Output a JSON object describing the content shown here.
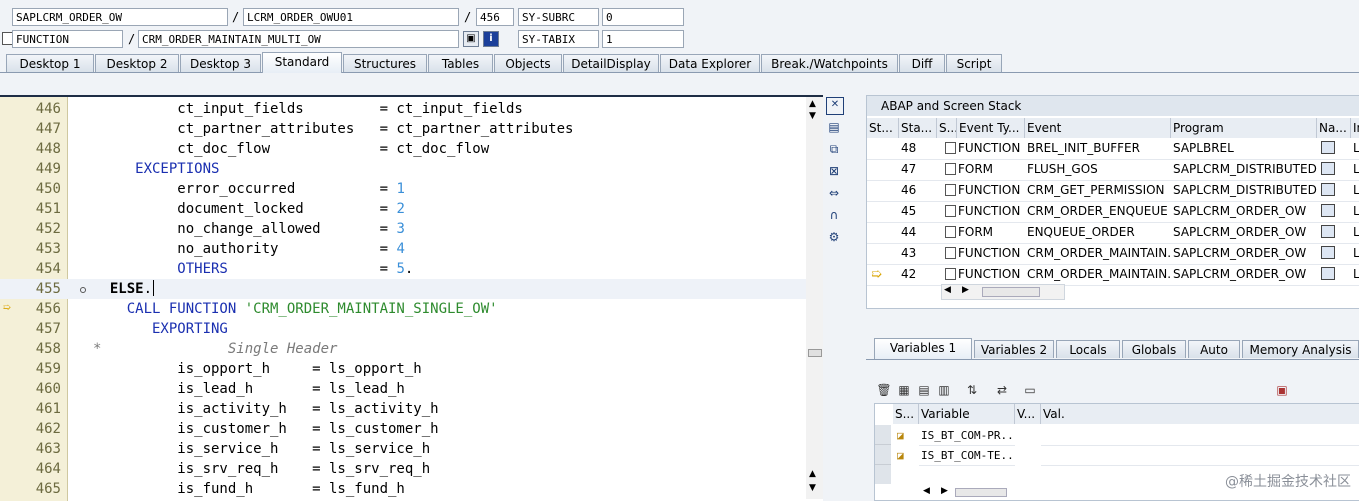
{
  "header": {
    "program": "SAPLCRM_ORDER_OW",
    "include": "LCRM_ORDER_OWU01",
    "line": "456",
    "sy_subrc_label": "SY-SUBRC",
    "sy_subrc_value": "0",
    "block_type": "FUNCTION",
    "block_name": "CRM_ORDER_MAINTAIN_MULTI_OW",
    "sy_tabix_label": "SY-TABIX",
    "sy_tabix_value": "1",
    "sep": "/"
  },
  "tabs": [
    "Desktop 1",
    "Desktop 2",
    "Desktop 3",
    "Standard",
    "Structures",
    "Tables",
    "Objects",
    "DetailDisplay",
    "Data Explorer",
    "Break./Watchpoints",
    "Diff",
    "Script"
  ],
  "active_tab": "Standard",
  "code": {
    "lines": [
      {
        "n": "446",
        "parts": [
          [
            "txt",
            "          ct_input_fields         = ct_input_fields"
          ]
        ]
      },
      {
        "n": "447",
        "parts": [
          [
            "txt",
            "          ct_partner_attributes   = ct_partner_attributes"
          ]
        ]
      },
      {
        "n": "448",
        "parts": [
          [
            "txt",
            "          ct_doc_flow             = ct_doc_flow"
          ]
        ]
      },
      {
        "n": "449",
        "parts": [
          [
            "kw",
            "     EXCEPTIONS"
          ]
        ]
      },
      {
        "n": "450",
        "parts": [
          [
            "txt",
            "          error_occurred          = "
          ],
          [
            "num",
            "1"
          ]
        ]
      },
      {
        "n": "451",
        "parts": [
          [
            "txt",
            "          document_locked         = "
          ],
          [
            "num",
            "2"
          ]
        ]
      },
      {
        "n": "452",
        "parts": [
          [
            "txt",
            "          no_change_allowed       = "
          ],
          [
            "num",
            "3"
          ]
        ]
      },
      {
        "n": "453",
        "parts": [
          [
            "txt",
            "          no_authority            = "
          ],
          [
            "num",
            "4"
          ]
        ]
      },
      {
        "n": "454",
        "parts": [
          [
            "kw",
            "          OTHERS"
          ],
          [
            "txt",
            "                  = "
          ],
          [
            "num",
            "5"
          ],
          [
            "txt",
            "."
          ]
        ]
      },
      {
        "n": "455",
        "parts": [
          [
            "bold",
            "  ELSE"
          ],
          [
            "txt",
            "."
          ]
        ]
      },
      {
        "n": "456",
        "parts": [
          [
            "kw",
            "    CALL FUNCTION "
          ],
          [
            "str",
            "'CRM_ORDER_MAINTAIN_SINGLE_OW'"
          ]
        ]
      },
      {
        "n": "457",
        "parts": [
          [
            "kw",
            "       EXPORTING"
          ]
        ]
      },
      {
        "n": "458",
        "parts": [
          [
            "cmt",
            "*               Single Header"
          ]
        ]
      },
      {
        "n": "459",
        "parts": [
          [
            "txt",
            "          is_opport_h     = ls_opport_h"
          ]
        ]
      },
      {
        "n": "460",
        "parts": [
          [
            "txt",
            "          is_lead_h       = ls_lead_h"
          ]
        ]
      },
      {
        "n": "461",
        "parts": [
          [
            "txt",
            "          is_activity_h   = ls_activity_h"
          ]
        ]
      },
      {
        "n": "462",
        "parts": [
          [
            "txt",
            "          is_customer_h   = ls_customer_h"
          ]
        ]
      },
      {
        "n": "463",
        "parts": [
          [
            "txt",
            "          is_service_h    = ls_service_h"
          ]
        ]
      },
      {
        "n": "464",
        "parts": [
          [
            "txt",
            "          is_srv_req_h    = ls_srv_req_h"
          ]
        ]
      },
      {
        "n": "465",
        "parts": [
          [
            "txt",
            "          is_fund_h       = ls_fund_h"
          ]
        ]
      }
    ],
    "current_line": "456",
    "cursor_line": "455"
  },
  "stack": {
    "title": "ABAP and Screen Stack",
    "columns": [
      "St...",
      "Sta...",
      "S...",
      "Event Ty...",
      "Event",
      "Program",
      "Na...",
      "In"
    ],
    "rows": [
      {
        "level": "48",
        "type": "FUNCTION",
        "event": "BREL_INIT_BUFFER",
        "program": "SAPLBREL",
        "inc": "LB"
      },
      {
        "level": "47",
        "type": "FORM",
        "event": "FLUSH_GOS",
        "program": "SAPLCRM_DISTRIBUTED...",
        "inc": "LC"
      },
      {
        "level": "46",
        "type": "FUNCTION",
        "event": "CRM_GET_PERMISSION",
        "program": "SAPLCRM_DISTRIBUTED...",
        "inc": "LC"
      },
      {
        "level": "45",
        "type": "FUNCTION",
        "event": "CRM_ORDER_ENQUEUE",
        "program": "SAPLCRM_ORDER_OW",
        "inc": "LC"
      },
      {
        "level": "44",
        "type": "FORM",
        "event": "ENQUEUE_ORDER",
        "program": "SAPLCRM_ORDER_OW",
        "inc": "LC"
      },
      {
        "level": "43",
        "type": "FUNCTION",
        "event": "CRM_ORDER_MAINTAIN...",
        "program": "SAPLCRM_ORDER_OW",
        "inc": "LC"
      },
      {
        "level": "42",
        "type": "FUNCTION",
        "event": "CRM_ORDER_MAINTAIN...",
        "program": "SAPLCRM_ORDER_OW",
        "inc": "LC",
        "current": true
      }
    ]
  },
  "var_tabs": [
    "Variables 1",
    "Variables 2",
    "Locals",
    "Globals",
    "Auto",
    "Memory Analysis"
  ],
  "var_active_tab": "Variables 1",
  "vars": {
    "columns": [
      "S...",
      "Variable",
      "V...",
      "Val."
    ],
    "rows": [
      {
        "name": "IS_BT_COM-PR...",
        "value": ""
      },
      {
        "name": "IS_BT_COM-TE...",
        "value": ""
      }
    ]
  },
  "watermark": "@稀土掘金技术社区",
  "colors": {
    "keyword": "#1a2fb0",
    "string": "#2e8b2e",
    "number": "#3a8fd8",
    "comment": "#7a7a7a"
  }
}
